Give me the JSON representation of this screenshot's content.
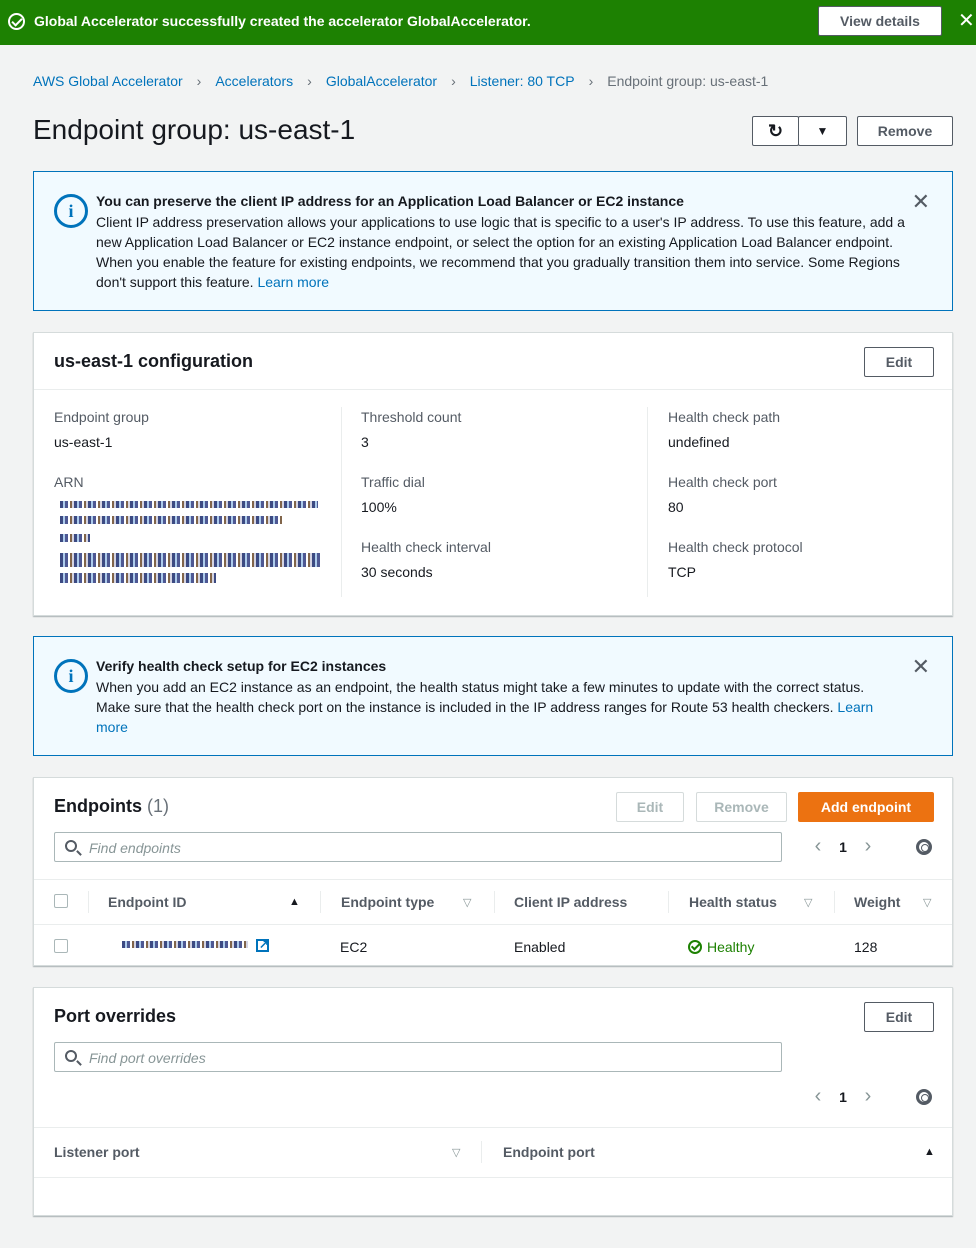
{
  "flash": {
    "message": "Global Accelerator successfully created the accelerator GlobalAccelerator.",
    "view_details": "View details",
    "close": "✕"
  },
  "breadcrumb": {
    "items": [
      "AWS Global Accelerator",
      "Accelerators",
      "GlobalAccelerator",
      "Listener: 80 TCP"
    ],
    "current": "Endpoint group: us-east-1"
  },
  "page": {
    "title": "Endpoint group: us-east-1",
    "remove_label": "Remove"
  },
  "info_client_ip": {
    "heading": "You can preserve the client IP address for an Application Load Balancer or EC2 instance",
    "body": "Client IP address preservation allows your applications to use logic that is specific to a user's IP address. To use this feature, add a new Application Load Balancer or EC2 instance endpoint, or select the option for an existing Application Load Balancer endpoint. When you enable the feature for existing endpoints, we recommend that you gradually transition them into service. Some Regions don't support this feature.",
    "link": "Learn more"
  },
  "config": {
    "title": "us-east-1 configuration",
    "edit_label": "Edit",
    "endpoint_group_label": "Endpoint group",
    "endpoint_group_value": "us-east-1",
    "arn_label": "ARN",
    "threshold_label": "Threshold count",
    "threshold_value": "3",
    "traffic_dial_label": "Traffic dial",
    "traffic_dial_value": "100%",
    "interval_label": "Health check interval",
    "interval_value": "30 seconds",
    "path_label": "Health check path",
    "path_value": "undefined",
    "port_label": "Health check port",
    "port_value": "80",
    "protocol_label": "Health check protocol",
    "protocol_value": "TCP"
  },
  "info_health": {
    "heading": "Verify health check setup for EC2 instances",
    "body": "When you add an EC2 instance as an endpoint, the health status might take a few minutes to update with the correct status. Make sure that the health check port on the instance is included in the IP address ranges for Route 53 health checkers.",
    "link": "Learn more"
  },
  "endpoints": {
    "title": "Endpoints",
    "count": "(1)",
    "edit_label": "Edit",
    "remove_label": "Remove",
    "add_label": "Add endpoint",
    "search_placeholder": "Find endpoints",
    "page": "1",
    "columns": [
      "Endpoint ID",
      "Endpoint type",
      "Client IP address",
      "Health status",
      "Weight"
    ],
    "rows": [
      {
        "type": "EC2",
        "client_ip": "Enabled",
        "health": "Healthy",
        "weight": "128"
      }
    ]
  },
  "port_overrides": {
    "title": "Port overrides",
    "edit_label": "Edit",
    "search_placeholder": "Find port overrides",
    "page": "1",
    "columns": [
      "Listener port",
      "Endpoint port"
    ]
  },
  "colors": {
    "success": "#1d8102",
    "link": "#0073bb",
    "primary": "#ec7211"
  }
}
